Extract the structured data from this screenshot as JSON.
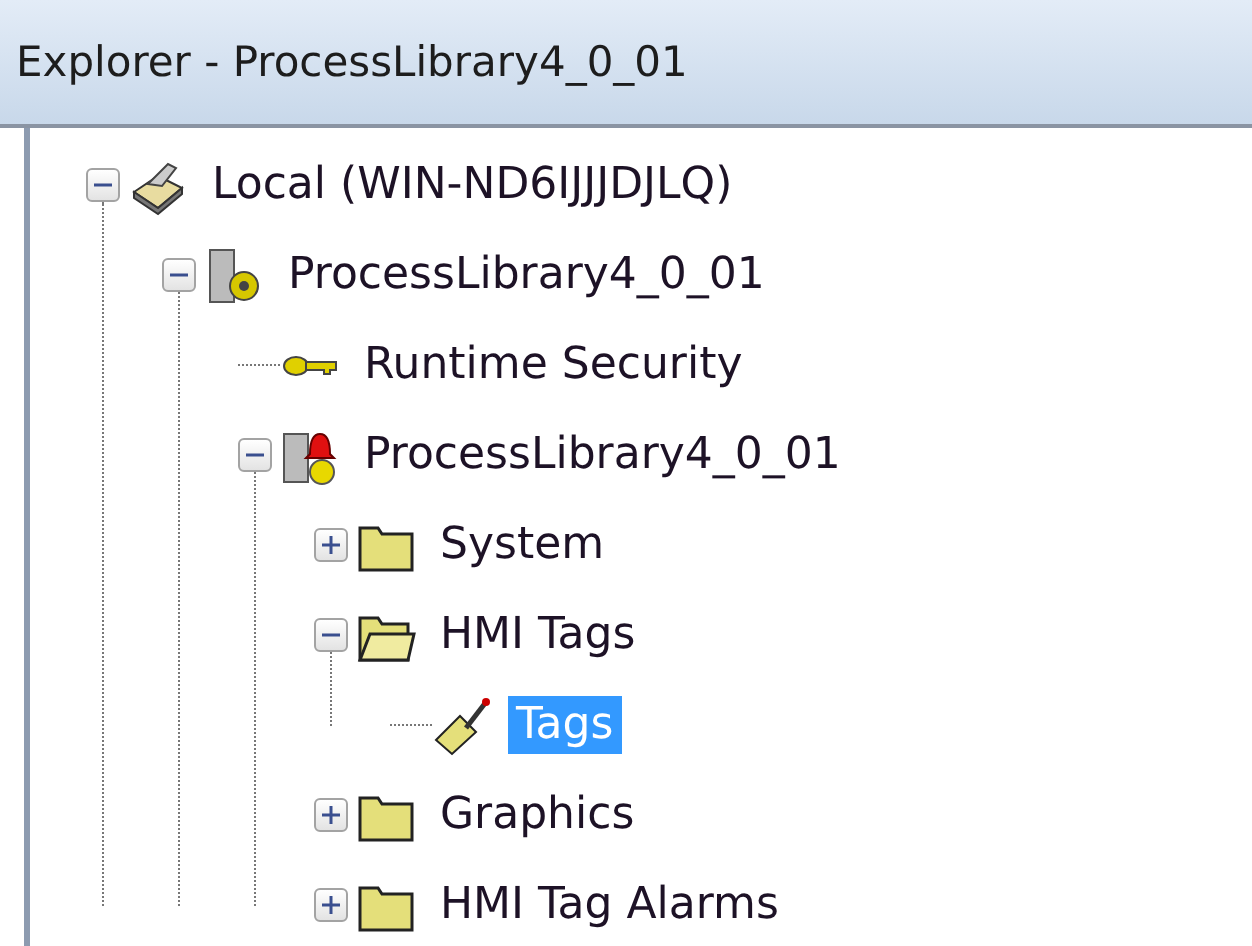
{
  "window": {
    "title": "Explorer - ProcessLibrary4_0_01"
  },
  "tree": [
    {
      "label": "Local (WIN-ND6IJJJDJLQ)",
      "kind": "computer",
      "expanded": true,
      "selected": false,
      "children": [
        {
          "label": "ProcessLibrary4_0_01",
          "kind": "project",
          "expanded": true,
          "selected": false,
          "children": [
            {
              "label": "Runtime Security",
              "kind": "key",
              "selected": false
            },
            {
              "label": "ProcessLibrary4_0_01",
              "kind": "node",
              "expanded": true,
              "selected": false,
              "children": [
                {
                  "label": "System",
                  "kind": "folder",
                  "expanded": false,
                  "selected": false
                },
                {
                  "label": "HMI Tags",
                  "kind": "folder",
                  "expanded": true,
                  "selected": false,
                  "children": [
                    {
                      "label": "Tags",
                      "kind": "tags",
                      "selected": true
                    }
                  ]
                },
                {
                  "label": "Graphics",
                  "kind": "folder",
                  "expanded": false,
                  "selected": false
                },
                {
                  "label": "HMI Tag Alarms",
                  "kind": "folder",
                  "expanded": false,
                  "selected": false
                }
              ]
            }
          ]
        }
      ]
    }
  ]
}
